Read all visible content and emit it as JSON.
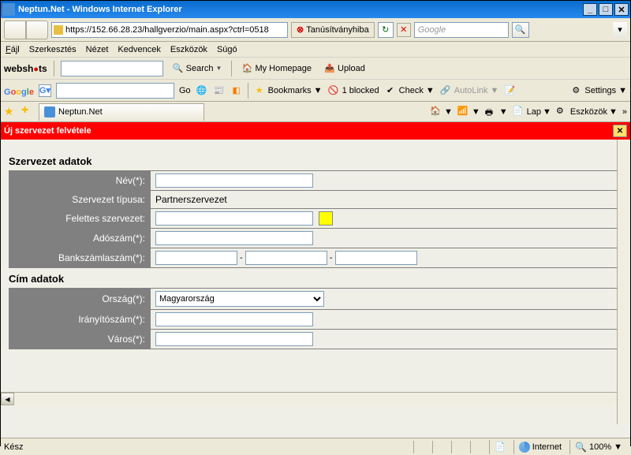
{
  "window": {
    "title": "Neptun.Net - Windows Internet Explorer"
  },
  "nav": {
    "url": "https://152.66.28.23/hallgverzio/main.aspx?ctrl=0518",
    "cert_label": "Tanúsítványhiba",
    "search_placeholder": "Google"
  },
  "menu": {
    "file": "Fájl",
    "edit": "Szerkesztés",
    "view": "Nézet",
    "favorites": "Kedvencek",
    "tools": "Eszközök",
    "help": "Súgó"
  },
  "webshots": {
    "search": "Search",
    "homepage": "My Homepage",
    "upload": "Upload"
  },
  "google": {
    "go": "Go",
    "bookmarks": "Bookmarks",
    "blocked": "1 blocked",
    "check": "Check",
    "autolink": "AutoLink",
    "settings": "Settings"
  },
  "tabs": {
    "title": "Neptun.Net",
    "lap": "Lap",
    "eszkozok": "Eszközök"
  },
  "banner": {
    "title": "Új szervezet felvétele"
  },
  "form": {
    "section1": "Szervezet adatok",
    "labels": {
      "nev": "Név(*):",
      "tipus": "Szervezet típusa:",
      "felettes": "Felettes szervezet:",
      "adoszam": "Adószám(*):",
      "bank": "Bankszámlaszám(*):"
    },
    "tipus_value": "Partnerszervezet",
    "section2": "Cím adatok",
    "labels2": {
      "orszag": "Ország(*):",
      "iranyito": "Irányítószám(*):",
      "varos": "Város(*):"
    },
    "orszag_value": "Magyarország"
  },
  "status": {
    "ready": "Kész",
    "zone": "Internet",
    "zoom": "100%"
  }
}
